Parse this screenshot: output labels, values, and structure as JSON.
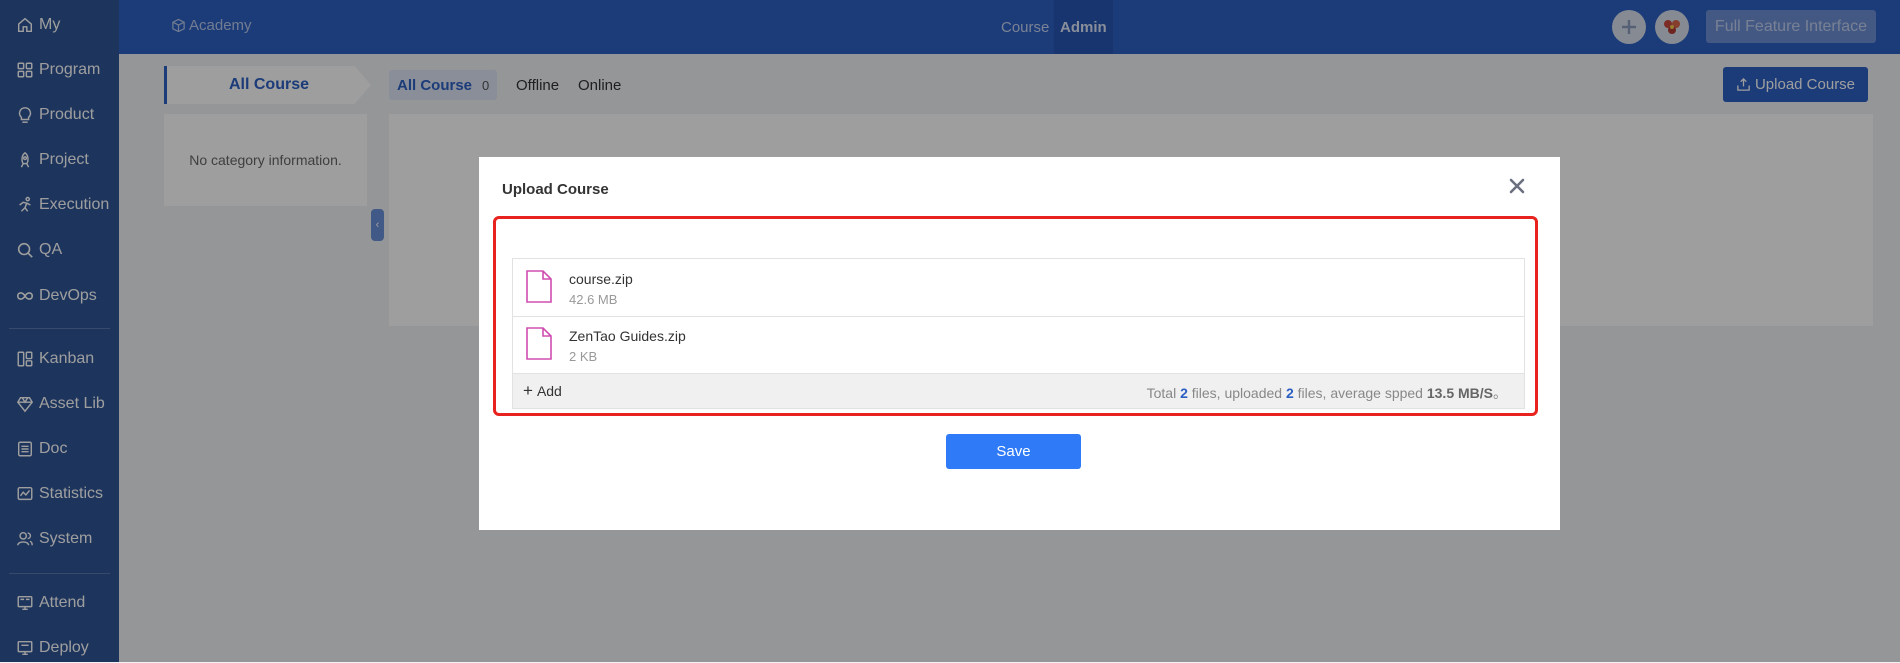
{
  "sidebar": {
    "items": [
      {
        "label": "My",
        "icon": "home-icon"
      },
      {
        "label": "Program",
        "icon": "grid-icon"
      },
      {
        "label": "Product",
        "icon": "bulb-icon"
      },
      {
        "label": "Project",
        "icon": "rocket-icon"
      },
      {
        "label": "Execution",
        "icon": "run-icon"
      },
      {
        "label": "QA",
        "icon": "search-icon"
      },
      {
        "label": "DevOps",
        "icon": "infinity-icon"
      },
      {
        "label": "Kanban",
        "icon": "kanban-icon"
      },
      {
        "label": "Asset Lib",
        "icon": "diamond-icon"
      },
      {
        "label": "Doc",
        "icon": "doc-icon"
      },
      {
        "label": "Statistics",
        "icon": "chart-icon"
      },
      {
        "label": "System",
        "icon": "users-icon"
      },
      {
        "label": "Attend",
        "icon": "attend-icon"
      },
      {
        "label": "Deploy",
        "icon": "deploy-icon"
      }
    ],
    "bg_color": "#2f5597"
  },
  "header": {
    "brand": "Academy",
    "tabs": [
      {
        "label": "Course",
        "active": false
      },
      {
        "label": "Admin",
        "active": true
      }
    ],
    "full_feature_label": "Full Feature Interface",
    "bg_color": "#2c5fc4"
  },
  "content": {
    "category_tab": "All Course",
    "category_empty": "No category information.",
    "sub_tabs": [
      {
        "label": "All Course",
        "count": "0",
        "active": true
      },
      {
        "label": "Offline",
        "active": false
      },
      {
        "label": "Online",
        "active": false
      }
    ],
    "upload_button": "Upload Course"
  },
  "modal": {
    "title": "Upload Course",
    "files": [
      {
        "name": "course.zip",
        "size": "42.6 MB"
      },
      {
        "name": "ZenTao Guides.zip",
        "size": "2 KB"
      }
    ],
    "add_label": "Add",
    "summary": {
      "prefix": "Total",
      "total": "2",
      "mid1": "files, uploaded",
      "uploaded": "2",
      "mid2": "files, average spped",
      "speed": "13.5 MB/S",
      "suffix": "。"
    },
    "save_label": "Save",
    "highlight_color": "#e8231f",
    "primary_color": "#2f7bf7"
  }
}
